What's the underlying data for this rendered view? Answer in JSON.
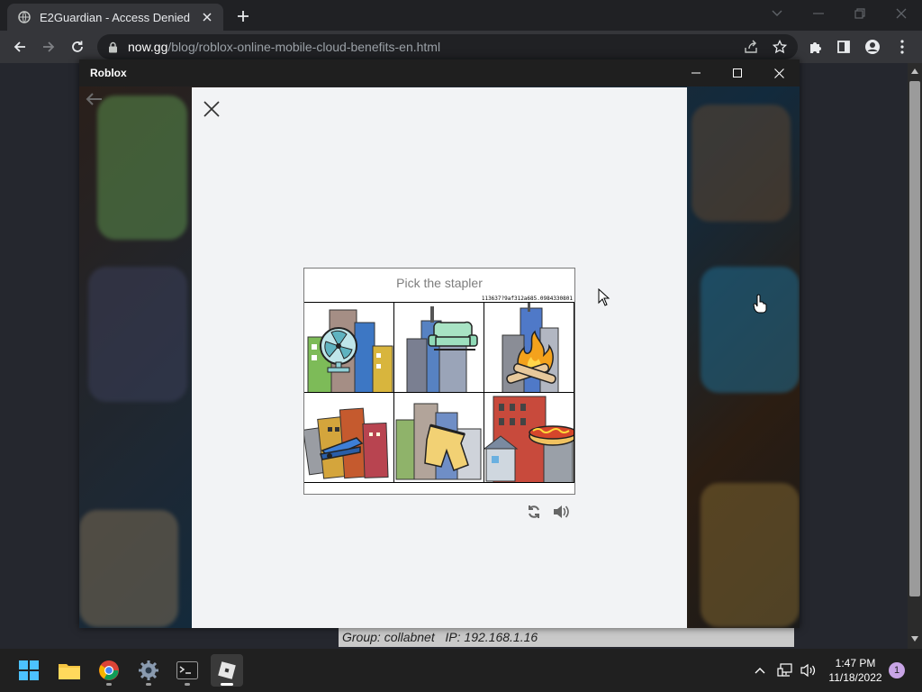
{
  "browser": {
    "tab": {
      "title": "E2Guardian - Access Denied"
    },
    "url": {
      "host": "now.gg",
      "path": "/blog/roblox-online-mobile-cloud-benefits-en.html"
    }
  },
  "page": {
    "footer": "Group: collabnet   IP: 192.168.1.16"
  },
  "roblox_window": {
    "title": "Roblox"
  },
  "captcha": {
    "prompt": "Pick the stapler",
    "challenge_id": "113637?9af312a685.0984330801",
    "tiles": [
      {
        "name": "fan"
      },
      {
        "name": "couch"
      },
      {
        "name": "campfire"
      },
      {
        "name": "stapler"
      },
      {
        "name": "shorts"
      },
      {
        "name": "hot-dog"
      }
    ]
  },
  "taskbar": {
    "time": "1:47 PM",
    "date": "11/18/2022",
    "notifications": "1"
  },
  "colors": {
    "chrome_dark": "#202124",
    "chrome_toolbar": "#35363a",
    "modal_bg": "#f2f3f5",
    "taskbar": "#202020"
  }
}
